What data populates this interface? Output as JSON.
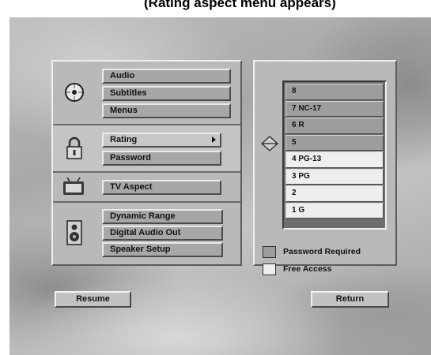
{
  "caption": "(Rating aspect menu appears)",
  "menu": {
    "groups": [
      {
        "icon": "disc-icon",
        "items": [
          {
            "label": "Audio"
          },
          {
            "label": "Subtitles"
          },
          {
            "label": "Menus"
          }
        ]
      },
      {
        "icon": "padlock-icon",
        "items": [
          {
            "label": "Rating"
          },
          {
            "label": "Password"
          }
        ]
      },
      {
        "icon": "tv-icon",
        "items": [
          {
            "label": "TV Aspect"
          }
        ]
      },
      {
        "icon": "speaker-icon",
        "items": [
          {
            "label": "Dynamic Range"
          },
          {
            "label": "Digital Audio Out"
          },
          {
            "label": "Speaker Setup"
          }
        ]
      }
    ],
    "selected_item": "Rating"
  },
  "ratings": {
    "scroll_icon": "up-down-diamond-icon",
    "items": [
      {
        "label": "8",
        "access": "Password Required"
      },
      {
        "label": "7 NC-17",
        "access": "Password Required"
      },
      {
        "label": "6 R",
        "access": "Password Required"
      },
      {
        "label": "5",
        "access": "Password Required"
      },
      {
        "label": "4 PG-13",
        "access": "Free Access"
      },
      {
        "label": "3 PG",
        "access": "Free Access"
      },
      {
        "label": "2",
        "access": "Free Access"
      },
      {
        "label": "1 G",
        "access": "Free Access"
      }
    ],
    "legend": {
      "password_required": "Password Required",
      "free_access": "Free Access"
    }
  },
  "buttons": {
    "resume": "Resume",
    "return": "Return"
  },
  "colors": {
    "password_required": "#9d9d9d",
    "free_access": "#eeeeee"
  }
}
